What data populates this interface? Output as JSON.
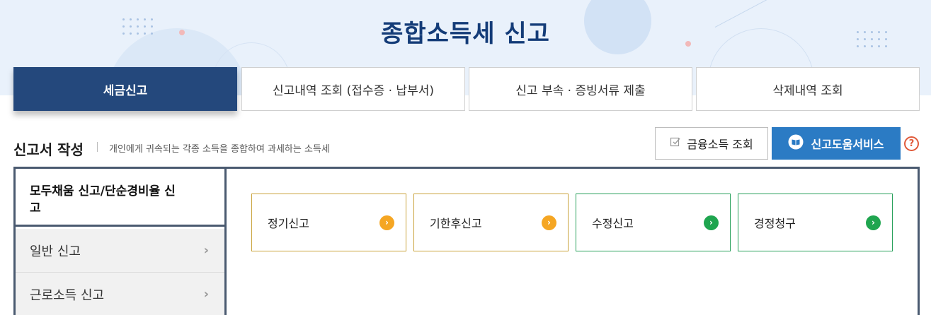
{
  "banner": {
    "title": "종합소득세 신고"
  },
  "tabs": [
    {
      "label": "세금신고",
      "active": true
    },
    {
      "label": "신고내역 조회 (접수증 · 납부서)",
      "active": false
    },
    {
      "label": "신고 부속 · 증빙서류 제출",
      "active": false
    },
    {
      "label": "삭제내역 조회",
      "active": false
    }
  ],
  "section": {
    "title": "신고서 작성",
    "description": "개인에게 귀속되는 각종 소득을 종합하여 과세하는 소득세"
  },
  "actions": {
    "financial_income_label": "금융소득 조회",
    "help_service_label": "신고도움서비스",
    "help_icon_text": "?"
  },
  "sidebar": {
    "items": [
      {
        "label": "모두채움 신고/단순경비율 신고",
        "active": true
      },
      {
        "label": "일반 신고",
        "active": false
      },
      {
        "label": "근로소득 신고",
        "active": false
      }
    ]
  },
  "cards": [
    {
      "label": "정기신고",
      "color": "orange"
    },
    {
      "label": "기한후신고",
      "color": "orange"
    },
    {
      "label": "수정신고",
      "color": "green"
    },
    {
      "label": "경정청구",
      "color": "green"
    }
  ],
  "colors": {
    "primary_navy": "#24487c",
    "help_blue": "#2b7bc4",
    "orange_accent": "#f5a623",
    "green_accent": "#1fa54f",
    "title_navy": "#143c78"
  }
}
